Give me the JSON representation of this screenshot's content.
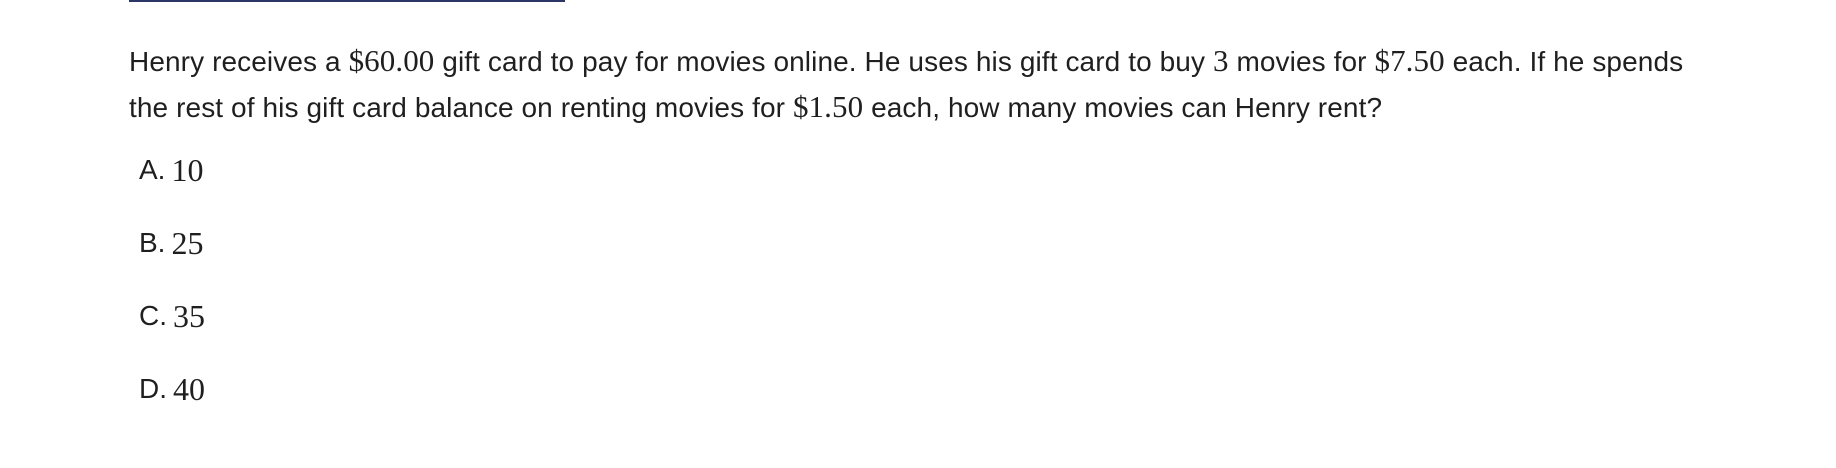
{
  "question": {
    "parts": [
      {
        "text": "Henry receives a ",
        "math": false
      },
      {
        "text": "$60.00",
        "math": true
      },
      {
        "text": " gift card to pay for movies online. He uses his gift card to buy ",
        "math": false
      },
      {
        "text": "3",
        "math": true
      },
      {
        "text": " movies for ",
        "math": false
      },
      {
        "text": "$7.50",
        "math": true
      },
      {
        "text": " each. If he spends the rest of his gift card balance on renting movies for ",
        "math": false
      },
      {
        "text": "$1.50",
        "math": true
      },
      {
        "text": " each, how many movies can Henry rent?",
        "math": false
      }
    ]
  },
  "choices": [
    {
      "letter": "A.",
      "value": "10"
    },
    {
      "letter": "B.",
      "value": "25"
    },
    {
      "letter": "C.",
      "value": "35"
    },
    {
      "letter": "D.",
      "value": "40"
    }
  ]
}
